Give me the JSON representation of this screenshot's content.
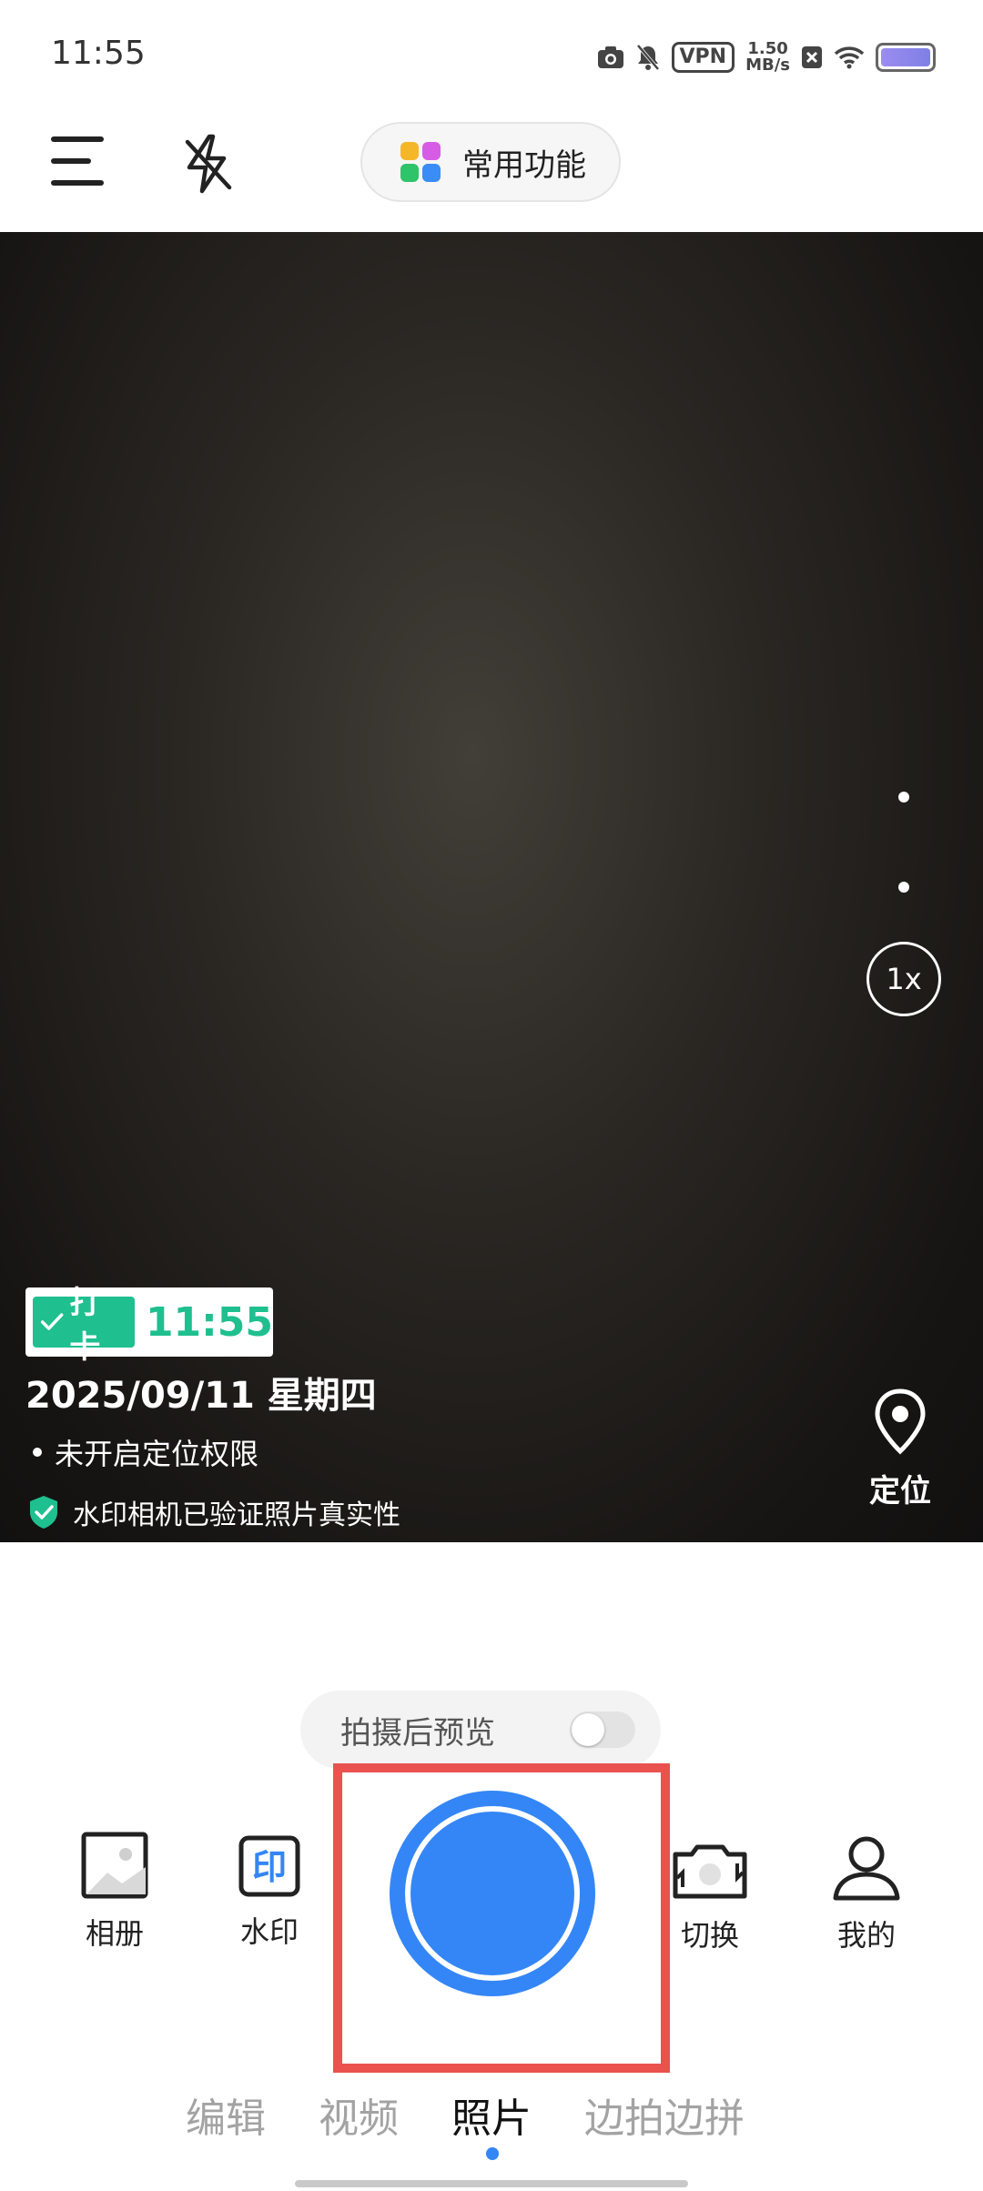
{
  "status_bar": {
    "time": "11:55",
    "vpn": "VPN",
    "speed_value": "1.50",
    "speed_unit": "MB/s"
  },
  "top_bar": {
    "common_functions_label": "常用功能"
  },
  "viewfinder": {
    "zoom_label": "1x",
    "watermark": {
      "tag": "打卡",
      "time": "11:55",
      "date": "2025/09/11 星期四",
      "location": "未开启定位权限"
    },
    "verify_text": "水印相机已验证照片真实性",
    "locate_label": "定位"
  },
  "preview": {
    "label": "拍摄后预览",
    "enabled": false
  },
  "tools": {
    "album": "相册",
    "watermark": "水印",
    "watermark_icon_text": "印",
    "switch": "切换",
    "mine": "我的"
  },
  "modes": [
    {
      "label": "编辑"
    },
    {
      "label": "视频"
    },
    {
      "label": "照片"
    },
    {
      "label": "边拍边拼"
    }
  ],
  "active_mode": "照片",
  "colors": {
    "accent": "#3486f6",
    "highlight_frame": "#e9524f",
    "watermark_green": "#1fbf8f"
  }
}
